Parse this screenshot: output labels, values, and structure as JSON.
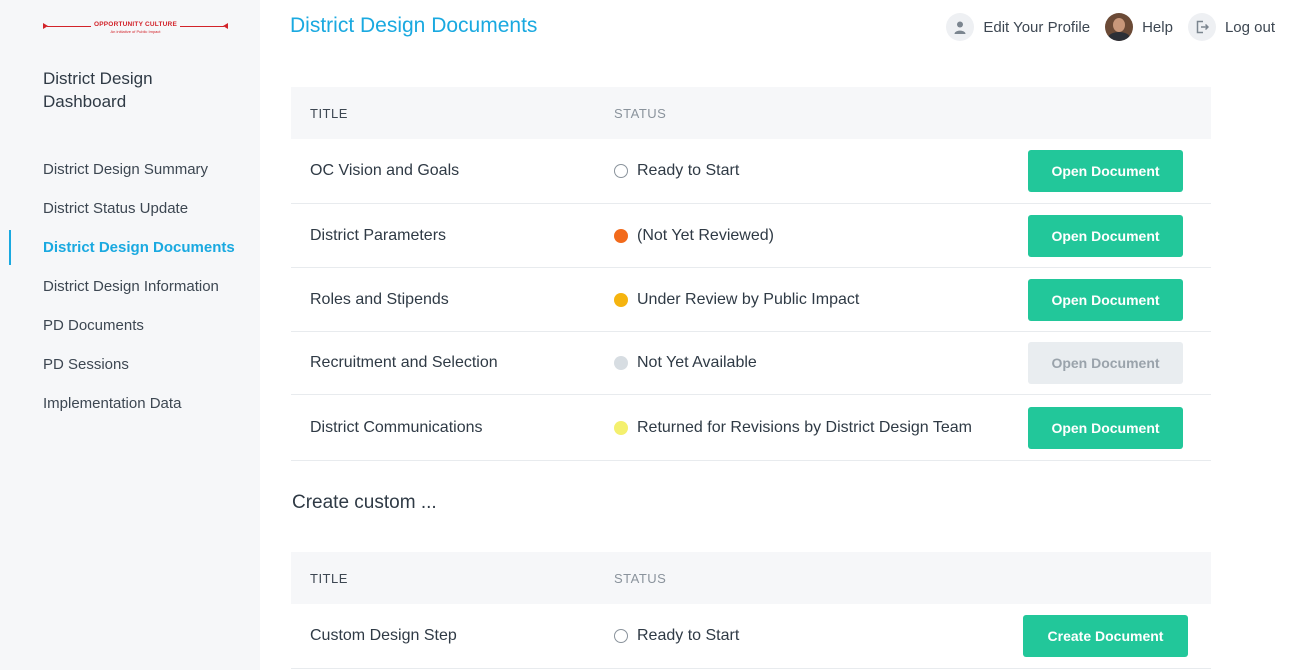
{
  "brand": {
    "logo_text": "OPPORTUNITY CULTURE",
    "logo_subtext": "An initiative of Public Impact",
    "logo_color": "#d2232a",
    "accent_color": "#1aa9e0",
    "button_color": "#22c79a"
  },
  "sidebar": {
    "title": "District Design Dashboard",
    "items": [
      {
        "label": "District Design Summary",
        "active": false
      },
      {
        "label": "District Status Update",
        "active": false
      },
      {
        "label": "District Design Documents",
        "active": true
      },
      {
        "label": "District Design Information",
        "active": false
      },
      {
        "label": "PD Documents",
        "active": false
      },
      {
        "label": "PD Sessions",
        "active": false
      },
      {
        "label": "Implementation Data",
        "active": false
      }
    ]
  },
  "header": {
    "page_title": "District Design Documents",
    "edit_profile": "Edit Your Profile",
    "help": "Help",
    "logout": "Log out"
  },
  "documents_table": {
    "col_title": "TITLE",
    "col_status": "STATUS",
    "rows": [
      {
        "title": "OC Vision and Goals",
        "status": "Ready to Start",
        "status_color": "empty",
        "button": "Open Document",
        "enabled": true
      },
      {
        "title": "District Parameters",
        "status": "(Not Yet Reviewed)",
        "status_color": "#f26a1b",
        "button": "Open Document",
        "enabled": true
      },
      {
        "title": "Roles and Stipends",
        "status": "Under Review by Public Impact",
        "status_color": "#f5b40f",
        "button": "Open Document",
        "enabled": true
      },
      {
        "title": "Recruitment and Selection",
        "status": "Not Yet Available",
        "status_color": "#d7dde2",
        "button": "Open Document",
        "enabled": false
      },
      {
        "title": "District Communications",
        "status": "Returned for Revisions by District Design Team",
        "status_color": "#f4f06e",
        "button": "Open Document",
        "enabled": true
      }
    ]
  },
  "custom_section": {
    "label": "Create custom ...",
    "col_title": "TITLE",
    "col_status": "STATUS",
    "rows": [
      {
        "title": "Custom Design Step",
        "status": "Ready to Start",
        "status_color": "empty",
        "button": "Create Document",
        "enabled": true
      }
    ]
  }
}
